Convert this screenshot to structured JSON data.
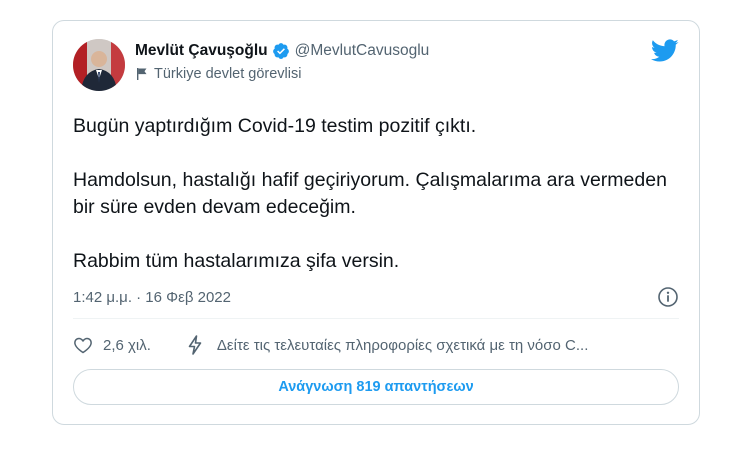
{
  "tweet": {
    "author": {
      "name": "Mevlüt Çavuşoğlu",
      "handle": "@MevlutCavusoglu",
      "label": "Türkiye devlet görevlisi",
      "verified": true
    },
    "text": {
      "p1": "Bugün yaptırdığım Covid-19 testim pozitif çıktı.",
      "p2": "Hamdolsun, hastalığı hafif geçiriyorum. Çalışmalarıma ara vermeden bir süre evden devam edeceğim.",
      "p3": "Rabbim tüm hastalarımıza şifa versin."
    },
    "timestamp": "1:42 μ.μ. · 16 Φεβ 2022",
    "likes": "2,6 χιλ.",
    "covid_notice": "Δείτε τις τελευταίες πληροφορίες σχετικά με τη νόσο C...",
    "replies_button": "Ανάγνωση 819 απαντήσεων"
  },
  "colors": {
    "accent": "#1d9bf0",
    "secondary_text": "#536471",
    "border": "#cfd9de"
  },
  "icons": [
    "avatar",
    "verified-badge-icon",
    "flag-icon",
    "twitter-bird-icon",
    "info-icon",
    "heart-icon",
    "lightning-bolt-icon"
  ]
}
